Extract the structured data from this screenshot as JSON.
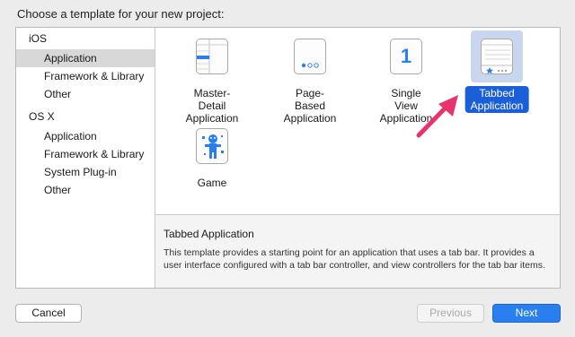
{
  "dialog": {
    "heading": "Choose a template for your new project:"
  },
  "sidebar": {
    "items": [
      {
        "label": "iOS",
        "kind": "group",
        "selected": false
      },
      {
        "label": "Application",
        "kind": "child",
        "selected": true
      },
      {
        "label": "Framework & Library",
        "kind": "child",
        "selected": false
      },
      {
        "label": "Other",
        "kind": "child",
        "selected": false
      },
      {
        "label": "OS X",
        "kind": "group",
        "selected": false
      },
      {
        "label": "Application",
        "kind": "child",
        "selected": false
      },
      {
        "label": "Framework & Library",
        "kind": "child",
        "selected": false
      },
      {
        "label": "System Plug-in",
        "kind": "child",
        "selected": false
      },
      {
        "label": "Other",
        "kind": "child",
        "selected": false
      }
    ]
  },
  "templates": [
    {
      "label": "Master-Detail\nApplication",
      "icon": "master-detail-icon",
      "selected": false
    },
    {
      "label": "Page-Based\nApplication",
      "icon": "page-based-icon",
      "selected": false
    },
    {
      "label": "Single View\nApplication",
      "icon": "single-view-icon",
      "glyph": "1",
      "selected": false
    },
    {
      "label": "Tabbed\nApplication",
      "icon": "tabbed-app-icon",
      "selected": true
    },
    {
      "label": "Game",
      "icon": "game-icon",
      "selected": false
    }
  ],
  "description": {
    "title": "Tabbed Application",
    "text": "This template provides a starting point for an application that uses a tab bar. It provides a user interface configured with a tab bar controller, and view controllers for the tab bar items."
  },
  "buttons": {
    "cancel": "Cancel",
    "previous": "Previous",
    "next": "Next"
  },
  "colors": {
    "accent": "#2a7ff0",
    "selection": "#1a5ed8",
    "arrow": "#e8336d"
  }
}
